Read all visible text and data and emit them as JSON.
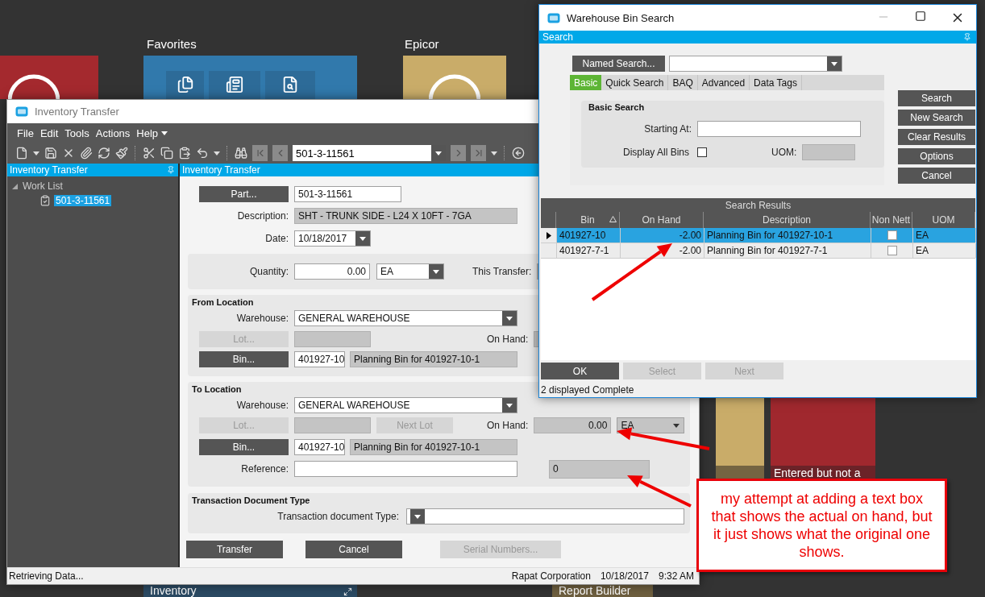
{
  "desktop": {
    "groups": [
      {
        "title": "Favorites"
      },
      {
        "title": "Epicor"
      }
    ],
    "tiles": [
      {
        "label": "Inventory"
      },
      {
        "label": "Report Builder"
      },
      {
        "label": "Entered but not a"
      }
    ]
  },
  "transfer_window": {
    "title": "Inventory Transfer",
    "menu": [
      "File",
      "Edit",
      "Tools",
      "Actions",
      "Help"
    ],
    "record": "501-3-11561",
    "tree_panel": {
      "title": "Inventory Transfer",
      "items": [
        {
          "label": "Work List",
          "expanded": true,
          "children": [
            {
              "label": "501-3-11561",
              "selected": true
            }
          ]
        }
      ]
    },
    "form_title": "Inventory Transfer",
    "part": {
      "button": "Part...",
      "value": "501-3-11561"
    },
    "description": {
      "label": "Description:",
      "value": "SHT - TRUNK SIDE - L24 X 10FT - 7GA"
    },
    "date": {
      "label": "Date:",
      "value": "10/18/2017"
    },
    "quantity": {
      "label": "Quantity:",
      "value": "0.00",
      "uom": "EA",
      "this_transfer_label": "This Transfer:"
    },
    "from_location": {
      "title": "From Location",
      "warehouse_label": "Warehouse:",
      "warehouse": "GENERAL WAREHOUSE",
      "lot_button": {
        "label": "Lot...",
        "disabled": true
      },
      "on_hand_label": "On Hand:",
      "bin_button": {
        "label": "Bin...",
        "disabled": false
      },
      "bin": "401927-10",
      "bin_description": "Planning Bin for 401927-10-1"
    },
    "to_location": {
      "title": "To Location",
      "warehouse_label": "Warehouse:",
      "warehouse": "GENERAL WAREHOUSE",
      "lot_button": {
        "label": "Lot...",
        "disabled": true
      },
      "next_lot_button": {
        "label": "Next Lot",
        "disabled": true
      },
      "on_hand_label": "On Hand:",
      "on_hand": "0.00",
      "on_hand_uom": "EA",
      "bin_button": {
        "label": "Bin...",
        "disabled": false
      },
      "bin": "401927-10",
      "bin_description": "Planning Bin for 401927-10-1",
      "reference_label": "Reference:",
      "added_box": "0"
    },
    "document_type": {
      "title": "Transaction Document Type",
      "label": "Transaction document Type:"
    },
    "buttons": [
      {
        "label": "Transfer",
        "disabled": false
      },
      {
        "label": "Cancel",
        "disabled": false
      },
      {
        "label": "Serial Numbers...",
        "disabled": true
      }
    ],
    "status_bar": {
      "message": "Retrieving Data...",
      "company": "Rapat Corporation",
      "date": "10/18/2017",
      "time": "9:32 AM"
    }
  },
  "bin_window": {
    "title": "Warehouse Bin Search",
    "search_header": "Search",
    "named_search": "Named Search...",
    "tabs": [
      {
        "label": "Basic",
        "selected": true
      },
      {
        "label": "Quick Search",
        "selected": false
      },
      {
        "label": "BAQ",
        "selected": false
      },
      {
        "label": "Advanced",
        "selected": false
      },
      {
        "label": "Data Tags",
        "selected": false
      }
    ],
    "basic_search": {
      "title": "Basic Search",
      "starting_at_label": "Starting At:",
      "display_all_label": "Display All Bins",
      "display_all_checked": false,
      "uom_label": "UOM:"
    },
    "side_buttons": [
      "Search",
      "New Search",
      "Clear Results",
      "Options",
      "Cancel"
    ],
    "results": {
      "title": "Search Results",
      "columns": [
        {
          "label": "Bin",
          "sorted": true
        },
        {
          "label": "On Hand",
          "sorted": false
        },
        {
          "label": "Description",
          "sorted": false
        },
        {
          "label": "Non Nett",
          "sorted": false
        },
        {
          "label": "UOM",
          "sorted": false
        }
      ],
      "rows": [
        {
          "bin": "401927-10",
          "on_hand": "-2.00",
          "description": "Planning Bin for 401927-10-1",
          "non_nett": false,
          "uom": "EA",
          "selected": true
        },
        {
          "bin": "401927-7-1",
          "on_hand": "-2.00",
          "description": "Planning Bin for 401927-7-1",
          "non_nett": false,
          "uom": "EA",
          "selected": false
        }
      ]
    },
    "footer_buttons": [
      {
        "label": "OK",
        "disabled": false
      },
      {
        "label": "Select",
        "disabled": true
      },
      {
        "label": "Next",
        "disabled": true
      }
    ],
    "status": "2 displayed Complete"
  },
  "annotation": {
    "text": "my attempt at adding a text box that shows the actual on hand, but it just shows what the original one shows."
  }
}
